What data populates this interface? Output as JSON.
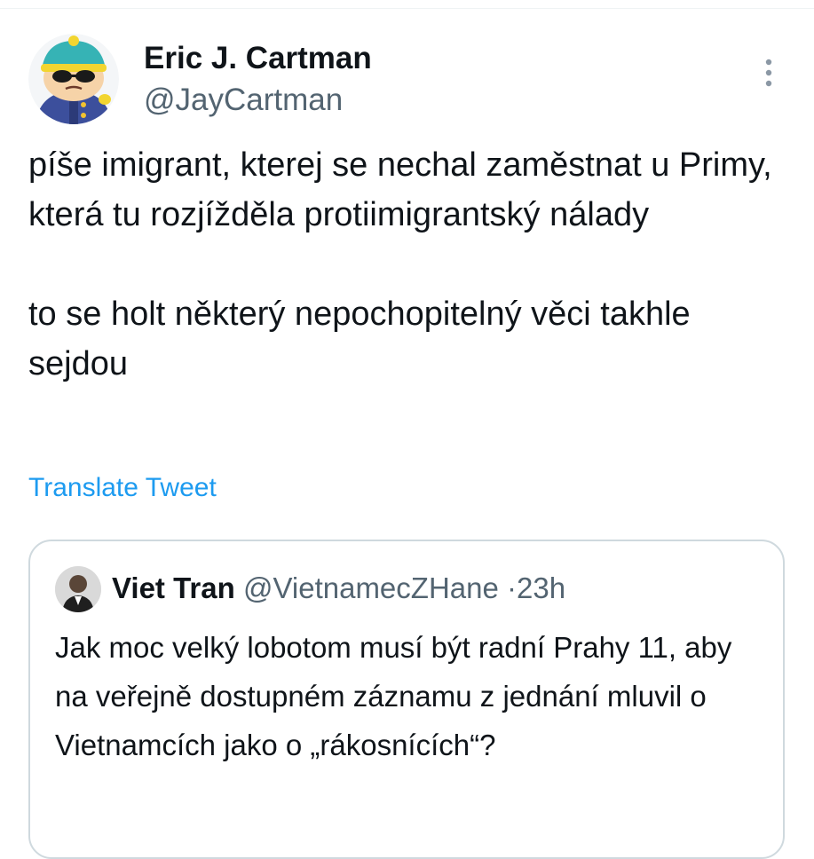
{
  "tweet": {
    "author": {
      "name": "Eric J. Cartman",
      "handle": "@JayCartman"
    },
    "text": "píše imigrant, kterej se nechal zaměstnat u Primy, která tu rozjížděla protiimigrantský nálady\n\nto se holt některý nepochopitelný věci takhle sejdou",
    "translate_label": "Translate Tweet"
  },
  "quoted_tweet": {
    "author_name": "Viet Tran",
    "author_handle": "@VietnamecZHane",
    "separator": "·",
    "time": "23h",
    "text": "Jak moc velký lobotom musí být radní Prahy 11, aby na veřejně dostupném záznamu z jednání mluvil o Vietnamcích jako o „rákosnících“?"
  },
  "colors": {
    "link": "#1d9bf0",
    "secondary_text": "#536471",
    "border": "#cfd9de"
  },
  "icons": {
    "more": "more-vertical-icon"
  }
}
